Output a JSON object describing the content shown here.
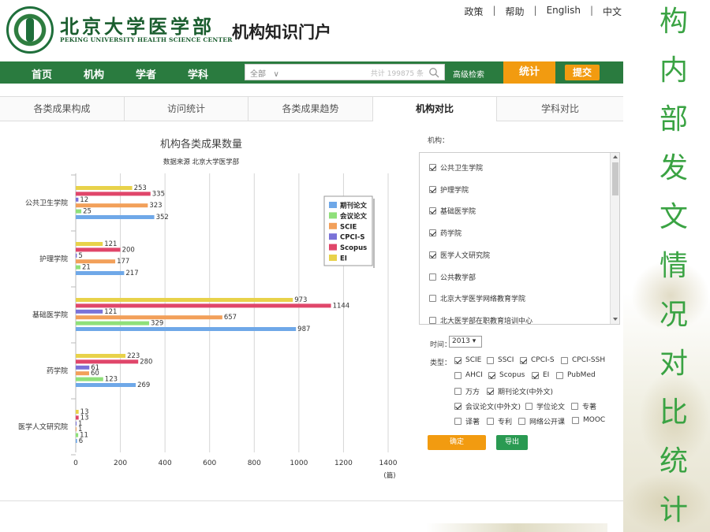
{
  "header": {
    "logo_cn": "北京大学医学部",
    "logo_en": "PEKING UNIVERSITY HEALTH SCIENCE CENTER",
    "portal_title": "机构知识门户",
    "links": [
      "政策",
      "帮助",
      "English",
      "中文"
    ]
  },
  "nav": {
    "items": [
      "首页",
      "机构",
      "学者",
      "学科"
    ],
    "search_scope": "全部",
    "search_count": "共计 199875 条",
    "adv_search": "高级检索",
    "stat_label": "统计",
    "submit_label": "提交"
  },
  "tabs": [
    "各类成果构成",
    "访问统计",
    "各类成果趋势",
    "机构对比",
    "学科对比"
  ],
  "active_tab": "机构对比",
  "chart_data": {
    "type": "bar",
    "orientation": "horizontal",
    "title": "机构各类成果数量",
    "subtitle": "数据来源 北京大学医学部",
    "categories": [
      "公共卫生学院",
      "护理学院",
      "基础医学院",
      "药学院",
      "医学人文研究院"
    ],
    "series": [
      {
        "name": "EI",
        "color": "#e8d24a",
        "values": [
          253,
          121,
          973,
          223,
          13
        ]
      },
      {
        "name": "Scopus",
        "color": "#e0466a",
        "values": [
          335,
          200,
          1144,
          280,
          13
        ]
      },
      {
        "name": "CPCI-S",
        "color": "#7a72d8",
        "values": [
          12,
          5,
          121,
          61,
          1
        ]
      },
      {
        "name": "SCIE",
        "color": "#f2a05a",
        "values": [
          323,
          177,
          657,
          60,
          1
        ]
      },
      {
        "name": "会议论文",
        "color": "#8fe07a",
        "values": [
          25,
          21,
          329,
          123,
          11
        ]
      },
      {
        "name": "期刊论文",
        "color": "#6fa8e8",
        "values": [
          352,
          217,
          987,
          269,
          6
        ]
      }
    ],
    "legend_order": [
      "期刊论文",
      "会议论文",
      "SCIE",
      "CPCI-S",
      "Scopus",
      "EI"
    ],
    "xlim": [
      0,
      1400
    ],
    "xticks": [
      0,
      200,
      400,
      600,
      800,
      1000,
      1200,
      1400
    ],
    "xunit": "(篇)",
    "grid": true,
    "legend_position": "right"
  },
  "panel": {
    "inst_label": "机构：",
    "institutions": [
      {
        "name": "公共卫生学院",
        "checked": true
      },
      {
        "name": "护理学院",
        "checked": true
      },
      {
        "name": "基础医学院",
        "checked": true
      },
      {
        "name": "药学院",
        "checked": true
      },
      {
        "name": "医学人文研究院",
        "checked": true
      },
      {
        "name": "公共教学部",
        "checked": false
      },
      {
        "name": "北京大学医学网络教育学院",
        "checked": false
      },
      {
        "name": "北大医学部在职教育培训中心",
        "checked": false
      }
    ],
    "time_label": "时间：",
    "time_value": "2013",
    "type_label": "类型：",
    "types": [
      {
        "name": "SCIE",
        "checked": true
      },
      {
        "name": "SSCI",
        "checked": false
      },
      {
        "name": "CPCI-S",
        "checked": true
      },
      {
        "name": "CPCI-SSH",
        "checked": false
      },
      {
        "name": "AHCI",
        "checked": false
      },
      {
        "name": "Scopus",
        "checked": true
      },
      {
        "name": "EI",
        "checked": true
      },
      {
        "name": "PubMed",
        "checked": false
      },
      {
        "name": "万方",
        "checked": false
      },
      {
        "name": "期刊论文(中外文)",
        "checked": true
      },
      {
        "name": "会议论文(中外文)",
        "checked": true
      },
      {
        "name": "学位论文",
        "checked": false
      },
      {
        "name": "专著",
        "checked": false
      },
      {
        "name": "译著",
        "checked": false
      },
      {
        "name": "专利",
        "checked": false
      },
      {
        "name": "网络公开课",
        "checked": false
      },
      {
        "name": "MOOC",
        "checked": false
      }
    ],
    "confirm_label": "确定",
    "export_label": "导出"
  },
  "side_text": [
    "构",
    "内",
    "部",
    "发",
    "文",
    "情",
    "况",
    "对",
    "比",
    "统",
    "计"
  ]
}
